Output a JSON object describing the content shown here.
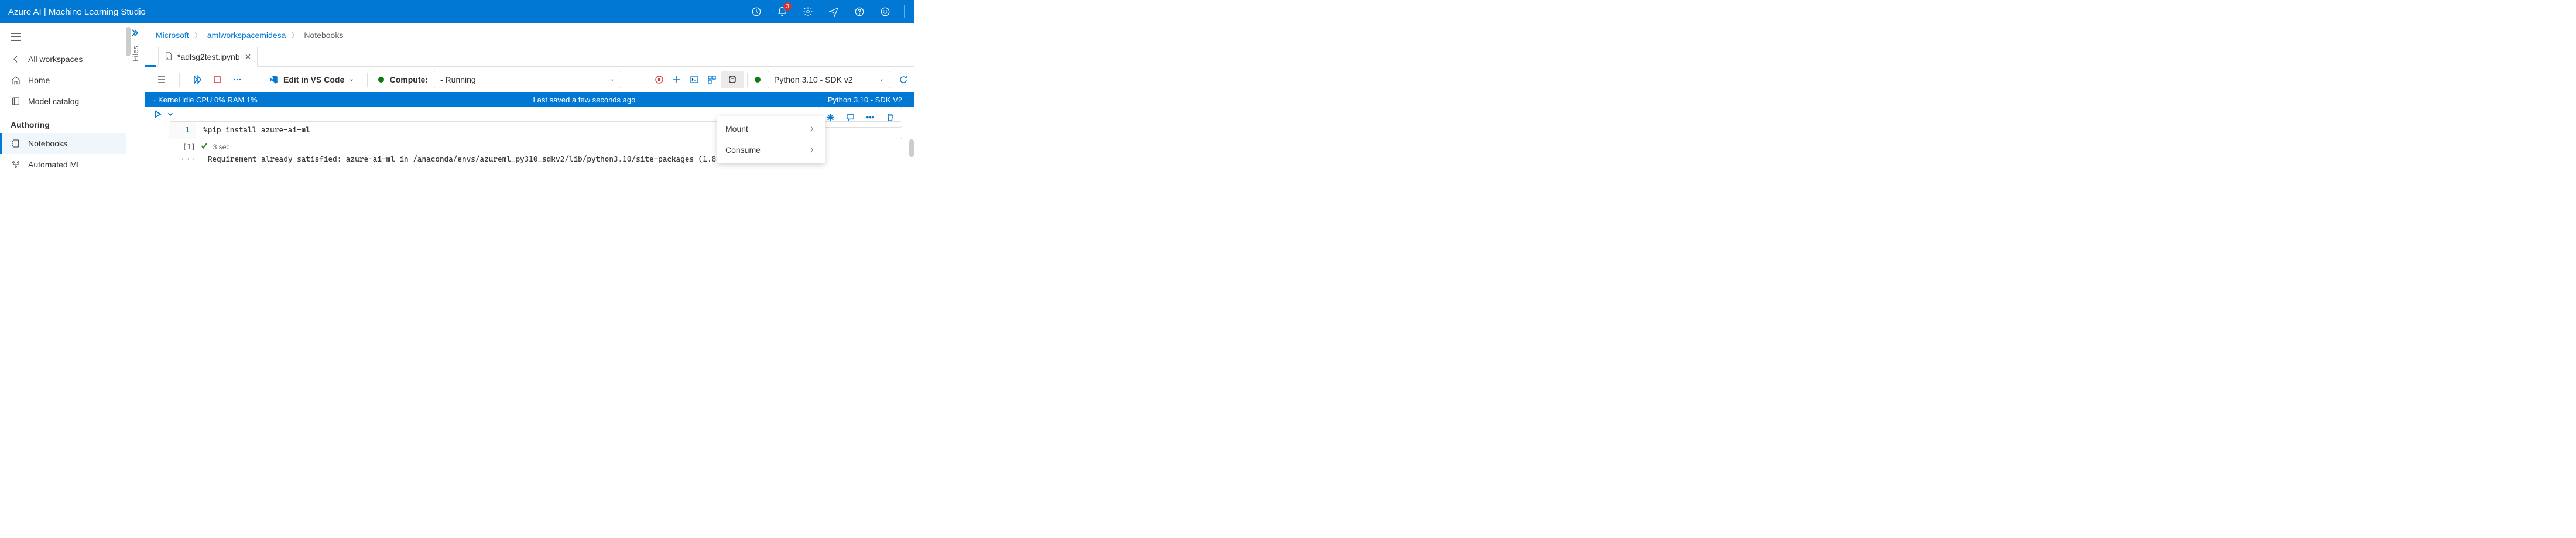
{
  "header": {
    "title": "Azure AI | Machine Learning Studio",
    "notifications_count": "3"
  },
  "nav": {
    "all_workspaces": "All workspaces",
    "home": "Home",
    "model_catalog": "Model catalog",
    "authoring_header": "Authoring",
    "notebooks": "Notebooks",
    "automated_ml": "Automated ML"
  },
  "files_sidebar_label": "Files",
  "breadcrumbs": {
    "root": "Microsoft",
    "workspace": "amlworkspacemidesa",
    "section": "Notebooks"
  },
  "tab": {
    "filename": "*adlsg2test.ipynb"
  },
  "toolbar": {
    "edit_vscode": "Edit in VS Code",
    "compute_label": "Compute:",
    "compute_value": "-    Running",
    "kernel_value": "Python 3.10 - SDK v2"
  },
  "status": {
    "kernel": "· Kernel idle  CPU   0%   RAM   1%",
    "saved": "Last saved a few seconds ago",
    "right": "Python 3.10 - SDK V2"
  },
  "dropdown": {
    "mount": "Mount",
    "consume": "Consume"
  },
  "cell": {
    "line_no": "1",
    "code": "%pip install azure-ai-ml",
    "exec_index": "[1]",
    "exec_time": "3 sec",
    "output": "Requirement already satisfied: azure-ai-ml in /anaconda/envs/azureml_py310_sdkv2/lib/python3.10/site-packages (1.8.0)"
  }
}
